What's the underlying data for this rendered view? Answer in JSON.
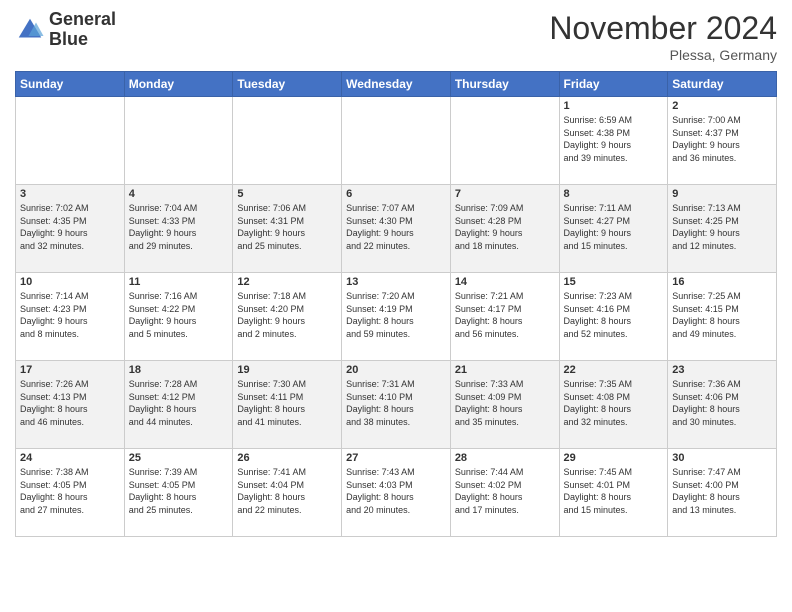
{
  "header": {
    "logo_line1": "General",
    "logo_line2": "Blue",
    "month": "November 2024",
    "location": "Plessa, Germany"
  },
  "days_of_week": [
    "Sunday",
    "Monday",
    "Tuesday",
    "Wednesday",
    "Thursday",
    "Friday",
    "Saturday"
  ],
  "weeks": [
    [
      {
        "day": "",
        "info": ""
      },
      {
        "day": "",
        "info": ""
      },
      {
        "day": "",
        "info": ""
      },
      {
        "day": "",
        "info": ""
      },
      {
        "day": "",
        "info": ""
      },
      {
        "day": "1",
        "info": "Sunrise: 6:59 AM\nSunset: 4:38 PM\nDaylight: 9 hours\nand 39 minutes."
      },
      {
        "day": "2",
        "info": "Sunrise: 7:00 AM\nSunset: 4:37 PM\nDaylight: 9 hours\nand 36 minutes."
      }
    ],
    [
      {
        "day": "3",
        "info": "Sunrise: 7:02 AM\nSunset: 4:35 PM\nDaylight: 9 hours\nand 32 minutes."
      },
      {
        "day": "4",
        "info": "Sunrise: 7:04 AM\nSunset: 4:33 PM\nDaylight: 9 hours\nand 29 minutes."
      },
      {
        "day": "5",
        "info": "Sunrise: 7:06 AM\nSunset: 4:31 PM\nDaylight: 9 hours\nand 25 minutes."
      },
      {
        "day": "6",
        "info": "Sunrise: 7:07 AM\nSunset: 4:30 PM\nDaylight: 9 hours\nand 22 minutes."
      },
      {
        "day": "7",
        "info": "Sunrise: 7:09 AM\nSunset: 4:28 PM\nDaylight: 9 hours\nand 18 minutes."
      },
      {
        "day": "8",
        "info": "Sunrise: 7:11 AM\nSunset: 4:27 PM\nDaylight: 9 hours\nand 15 minutes."
      },
      {
        "day": "9",
        "info": "Sunrise: 7:13 AM\nSunset: 4:25 PM\nDaylight: 9 hours\nand 12 minutes."
      }
    ],
    [
      {
        "day": "10",
        "info": "Sunrise: 7:14 AM\nSunset: 4:23 PM\nDaylight: 9 hours\nand 8 minutes."
      },
      {
        "day": "11",
        "info": "Sunrise: 7:16 AM\nSunset: 4:22 PM\nDaylight: 9 hours\nand 5 minutes."
      },
      {
        "day": "12",
        "info": "Sunrise: 7:18 AM\nSunset: 4:20 PM\nDaylight: 9 hours\nand 2 minutes."
      },
      {
        "day": "13",
        "info": "Sunrise: 7:20 AM\nSunset: 4:19 PM\nDaylight: 8 hours\nand 59 minutes."
      },
      {
        "day": "14",
        "info": "Sunrise: 7:21 AM\nSunset: 4:17 PM\nDaylight: 8 hours\nand 56 minutes."
      },
      {
        "day": "15",
        "info": "Sunrise: 7:23 AM\nSunset: 4:16 PM\nDaylight: 8 hours\nand 52 minutes."
      },
      {
        "day": "16",
        "info": "Sunrise: 7:25 AM\nSunset: 4:15 PM\nDaylight: 8 hours\nand 49 minutes."
      }
    ],
    [
      {
        "day": "17",
        "info": "Sunrise: 7:26 AM\nSunset: 4:13 PM\nDaylight: 8 hours\nand 46 minutes."
      },
      {
        "day": "18",
        "info": "Sunrise: 7:28 AM\nSunset: 4:12 PM\nDaylight: 8 hours\nand 44 minutes."
      },
      {
        "day": "19",
        "info": "Sunrise: 7:30 AM\nSunset: 4:11 PM\nDaylight: 8 hours\nand 41 minutes."
      },
      {
        "day": "20",
        "info": "Sunrise: 7:31 AM\nSunset: 4:10 PM\nDaylight: 8 hours\nand 38 minutes."
      },
      {
        "day": "21",
        "info": "Sunrise: 7:33 AM\nSunset: 4:09 PM\nDaylight: 8 hours\nand 35 minutes."
      },
      {
        "day": "22",
        "info": "Sunrise: 7:35 AM\nSunset: 4:08 PM\nDaylight: 8 hours\nand 32 minutes."
      },
      {
        "day": "23",
        "info": "Sunrise: 7:36 AM\nSunset: 4:06 PM\nDaylight: 8 hours\nand 30 minutes."
      }
    ],
    [
      {
        "day": "24",
        "info": "Sunrise: 7:38 AM\nSunset: 4:05 PM\nDaylight: 8 hours\nand 27 minutes."
      },
      {
        "day": "25",
        "info": "Sunrise: 7:39 AM\nSunset: 4:05 PM\nDaylight: 8 hours\nand 25 minutes."
      },
      {
        "day": "26",
        "info": "Sunrise: 7:41 AM\nSunset: 4:04 PM\nDaylight: 8 hours\nand 22 minutes."
      },
      {
        "day": "27",
        "info": "Sunrise: 7:43 AM\nSunset: 4:03 PM\nDaylight: 8 hours\nand 20 minutes."
      },
      {
        "day": "28",
        "info": "Sunrise: 7:44 AM\nSunset: 4:02 PM\nDaylight: 8 hours\nand 17 minutes."
      },
      {
        "day": "29",
        "info": "Sunrise: 7:45 AM\nSunset: 4:01 PM\nDaylight: 8 hours\nand 15 minutes."
      },
      {
        "day": "30",
        "info": "Sunrise: 7:47 AM\nSunset: 4:00 PM\nDaylight: 8 hours\nand 13 minutes."
      }
    ]
  ]
}
